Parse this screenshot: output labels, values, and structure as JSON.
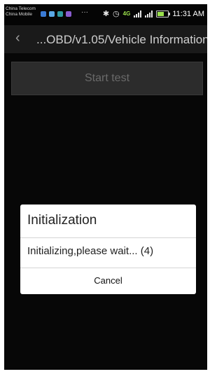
{
  "status_bar": {
    "carrier_1": "China Telecom",
    "carrier_2": "China Mobile",
    "app_icons": [
      "app-icon-blue",
      "app-icon-lightblue",
      "app-icon-teal",
      "app-icon-purple"
    ],
    "more": "···",
    "network": "4G",
    "time": "11:31 AM",
    "battery_level": 0.55
  },
  "header": {
    "back_icon": "chevron-left-icon",
    "title": "...OBD/v1.05/Vehicle Information"
  },
  "main": {
    "start_button_label": "Start test"
  },
  "dialog": {
    "title": "Initialization",
    "message": "Initializing,please wait... (4)",
    "cancel_label": "Cancel"
  },
  "colors": {
    "accent_status": "#9be14c",
    "dialog_bg": "#ffffff",
    "screen_bg": "#000000"
  }
}
